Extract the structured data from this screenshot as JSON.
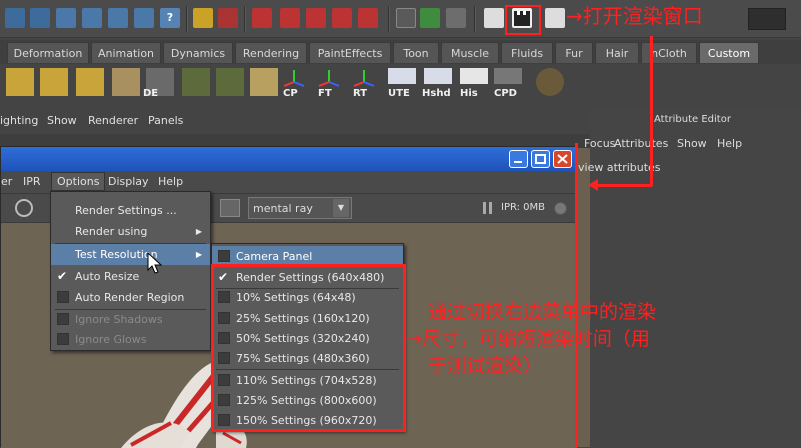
{
  "top_toolbar": {
    "annotation": "→打开渲染窗口"
  },
  "shelf_tabs": [
    "Deformation",
    "Animation",
    "Dynamics",
    "Rendering",
    "PaintEffects",
    "Toon",
    "Muscle",
    "Fluids",
    "Fur",
    "Hair",
    "nCloth",
    "Custom"
  ],
  "shelf_labels": [
    "DE",
    "CP",
    "FT",
    "RT",
    "UTE",
    "Hshd",
    "His",
    "CPD"
  ],
  "panel_menu": [
    "ighting",
    "Show",
    "Renderer",
    "Panels"
  ],
  "attribute_editor": {
    "title": "Attribute Editor",
    "menu": [
      "Focus",
      "Attributes",
      "Show",
      "Help"
    ],
    "hint": "view attributes"
  },
  "render_window": {
    "menu": [
      "er",
      "IPR",
      "Options",
      "Display",
      "Help"
    ],
    "renderer": "mental ray",
    "ipr_status": "IPR: 0MB"
  },
  "options_menu": {
    "items": [
      {
        "label": "Render Settings ...",
        "type": "item"
      },
      {
        "label": "Render using",
        "type": "submenu"
      },
      {
        "label": "Test Resolution",
        "type": "submenu",
        "highlight": true
      },
      {
        "label": "Auto Resize",
        "type": "check",
        "checked": true
      },
      {
        "label": "Auto Render Region",
        "type": "check",
        "checked": false
      },
      {
        "label": "Ignore Shadows",
        "type": "check",
        "disabled": true
      },
      {
        "label": "Ignore Glows",
        "type": "check",
        "disabled": true
      }
    ]
  },
  "resolution_menu": {
    "items": [
      {
        "label": "Camera Panel",
        "checked": false,
        "highlight": true
      },
      {
        "label": "Render Settings (640x480)",
        "checked": true
      },
      {
        "label": "10% Settings (64x48)",
        "checked": false
      },
      {
        "label": "25% Settings (160x120)",
        "checked": false
      },
      {
        "label": "50% Settings (320x240)",
        "checked": false
      },
      {
        "label": "75% Settings (480x360)",
        "checked": false
      },
      {
        "label": "110% Settings (704x528)",
        "checked": false
      },
      {
        "label": "125% Settings (800x600)",
        "checked": false
      },
      {
        "label": "150% Settings (960x720)",
        "checked": false
      }
    ]
  },
  "annotation_side": {
    "line1": "通过切换右边菜单中的渲染",
    "line2": "→尺寸，可缩短渲染时间（用",
    "line3": "于测试渲染）"
  },
  "colors": {
    "annotation_red": "#ff2020",
    "title_blue": "#2f6ed8",
    "highlight": "#5b7fa6"
  }
}
